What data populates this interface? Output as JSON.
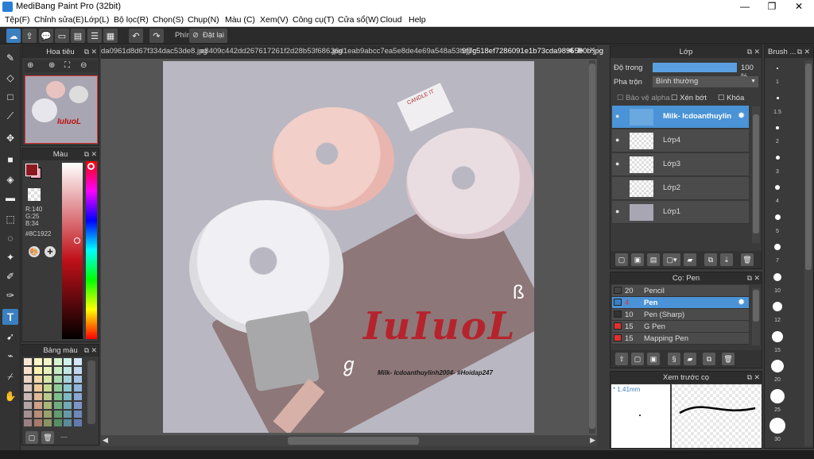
{
  "app": {
    "title": "MediBang Paint Pro (32bit)"
  },
  "window": {
    "minimize": "—",
    "maximize": "❐",
    "close": "✕"
  },
  "menu": [
    "Tệp(F)",
    "Chỉnh sửa(E)",
    "Lớp(L)",
    "Bộ lọc(R)",
    "Chọn(S)",
    "Chụp(N)",
    "Màu (C)",
    "Xem(V)",
    "Công cụ(T)",
    "Cửa sổ(W)",
    "Cloud",
    "Help"
  ],
  "toolbar": {
    "stabilizer_label": "Phím",
    "reset_label": "Đặt lại"
  },
  "navigator": {
    "title": "Hoa tiêu"
  },
  "color_panel": {
    "title": "Màu",
    "r": "R:140",
    "g": "G:25",
    "b": "B:34",
    "hex": "#8C1922",
    "primary": "#8c1922",
    "secondary": "#e8a0b8"
  },
  "palette": {
    "title": "Bảng màu",
    "footer": "---"
  },
  "tabs": [
    "da0961d8d67f334dac53de8.jpg",
    "e8409c442dd267617261f2d28b53f686.jpg",
    "36d1eab9abcc7ea5e8de4e69a548a53b.jpg",
    "9f7c518ef7286091e1b73cda9895580b.jpg"
  ],
  "artwork": {
    "logo_text": "IuIuoL",
    "caption": "Milk- lcdoanthuylinh2004- #Hoidap247",
    "doodle_1": "ß",
    "doodle_2": "ℊ",
    "box_text": "CANDLE IT"
  },
  "layers": {
    "title": "Lớp",
    "opacity_label": "Độ trong",
    "opacity_value": "100 %",
    "opacity": 1.0,
    "blend_label": "Pha trộn",
    "blend_value": "Bình thường",
    "protect_alpha": "Bảo vệ alpha",
    "clip": "Xén bớt",
    "lock": "Khóa",
    "items": [
      {
        "name": "Milk- lcdoanthuylin",
        "selected": true
      },
      {
        "name": "Lớp4",
        "selected": false
      },
      {
        "name": "Lớp3",
        "selected": false
      },
      {
        "name": "Lớp2",
        "selected": false
      },
      {
        "name": "Lớp1",
        "selected": false
      }
    ]
  },
  "brush_panel": {
    "title": "Cọ: Pen",
    "items": [
      {
        "size": "20",
        "name": "Pencil",
        "color": "#444444"
      },
      {
        "size": "4",
        "name": "Pen",
        "color": "#3a7fc0",
        "selected": true
      },
      {
        "size": "10",
        "name": "Pen (Sharp)",
        "color": "#333333"
      },
      {
        "size": "15",
        "name": "G Pen",
        "color": "#e03030"
      },
      {
        "size": "15",
        "name": "Mapping Pen",
        "color": "#e03030"
      }
    ]
  },
  "preview": {
    "title": "Xem trước cọ",
    "size": "* 1.41mm"
  },
  "brush_size": {
    "title": "Brush ...",
    "sizes": [
      "1",
      "1.5",
      "2",
      "3",
      "4",
      "5",
      "7",
      "10",
      "12",
      "15",
      "20",
      "25",
      "30"
    ]
  }
}
